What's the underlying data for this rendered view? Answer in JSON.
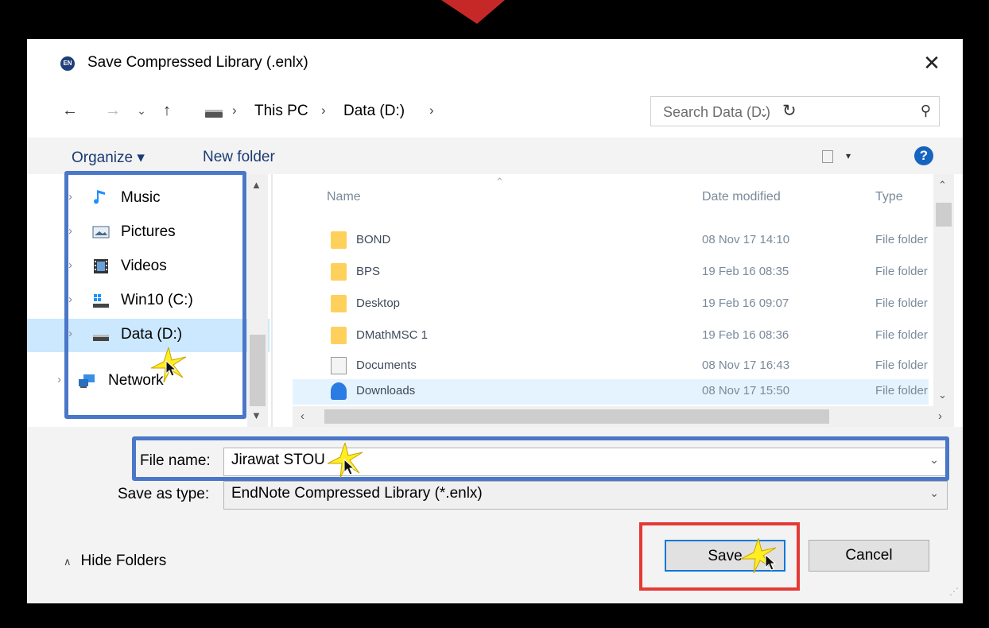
{
  "window": {
    "title": "Save Compressed Library (.enlx)",
    "app_icon": "EN"
  },
  "navbar": {
    "back_icon": "←",
    "forward_icon": "→",
    "recent_icon": "⌄",
    "up_icon": "↑",
    "breadcrumb": [
      "This PC",
      "Data (D:)"
    ],
    "separator": "›",
    "refresh_icon": "↻",
    "search_placeholder": "Search Data (D:)",
    "search_icon": "⚲"
  },
  "toolbar": {
    "organize_label": "Organize ▾",
    "new_folder_label": "New folder",
    "view_dropdown": "▾",
    "help_label": "?"
  },
  "nav_pane": {
    "items": [
      {
        "label": "Music",
        "icon": "music-icon"
      },
      {
        "label": "Pictures",
        "icon": "pictures-icon"
      },
      {
        "label": "Videos",
        "icon": "videos-icon"
      },
      {
        "label": "Win10 (C:)",
        "icon": "drive-c-icon"
      },
      {
        "label": "Data (D:)",
        "icon": "drive-d-icon",
        "selected": true
      },
      {
        "label": "Network",
        "icon": "network-icon"
      }
    ]
  },
  "file_list": {
    "columns": {
      "name": "Name",
      "date": "Date modified",
      "type": "Type"
    },
    "rows": [
      {
        "name": "BOND",
        "date": "08 Nov 17 14:10",
        "type": "File folder",
        "icon": "folder-icon"
      },
      {
        "name": "BPS",
        "date": "19 Feb 16 08:35",
        "type": "File folder",
        "icon": "folder-icon"
      },
      {
        "name": "Desktop",
        "date": "19 Feb 16 09:07",
        "type": "File folder",
        "icon": "folder-icon"
      },
      {
        "name": "DMathMSC 1",
        "date": "19 Feb 16 08:36",
        "type": "File folder",
        "icon": "folder-icon"
      },
      {
        "name": "Documents",
        "date": "08 Nov 17 16:43",
        "type": "File folder",
        "icon": "documents-icon"
      },
      {
        "name": "Downloads",
        "date": "08 Nov 17 15:50",
        "type": "File folder",
        "icon": "downloads-icon"
      }
    ]
  },
  "form": {
    "file_name_label": "File name:",
    "file_name_value": "Jirawat STOU",
    "save_type_label": "Save as type:",
    "save_type_value": "EndNote Compressed Library (*.enlx)"
  },
  "buttons": {
    "save": "Save",
    "cancel": "Cancel",
    "hide_folders": "Hide Folders"
  },
  "colors": {
    "highlight_blue": "#4a77c9",
    "highlight_red": "#e53935",
    "spark_yellow": "#ffee22",
    "accent": "#0078d7"
  }
}
